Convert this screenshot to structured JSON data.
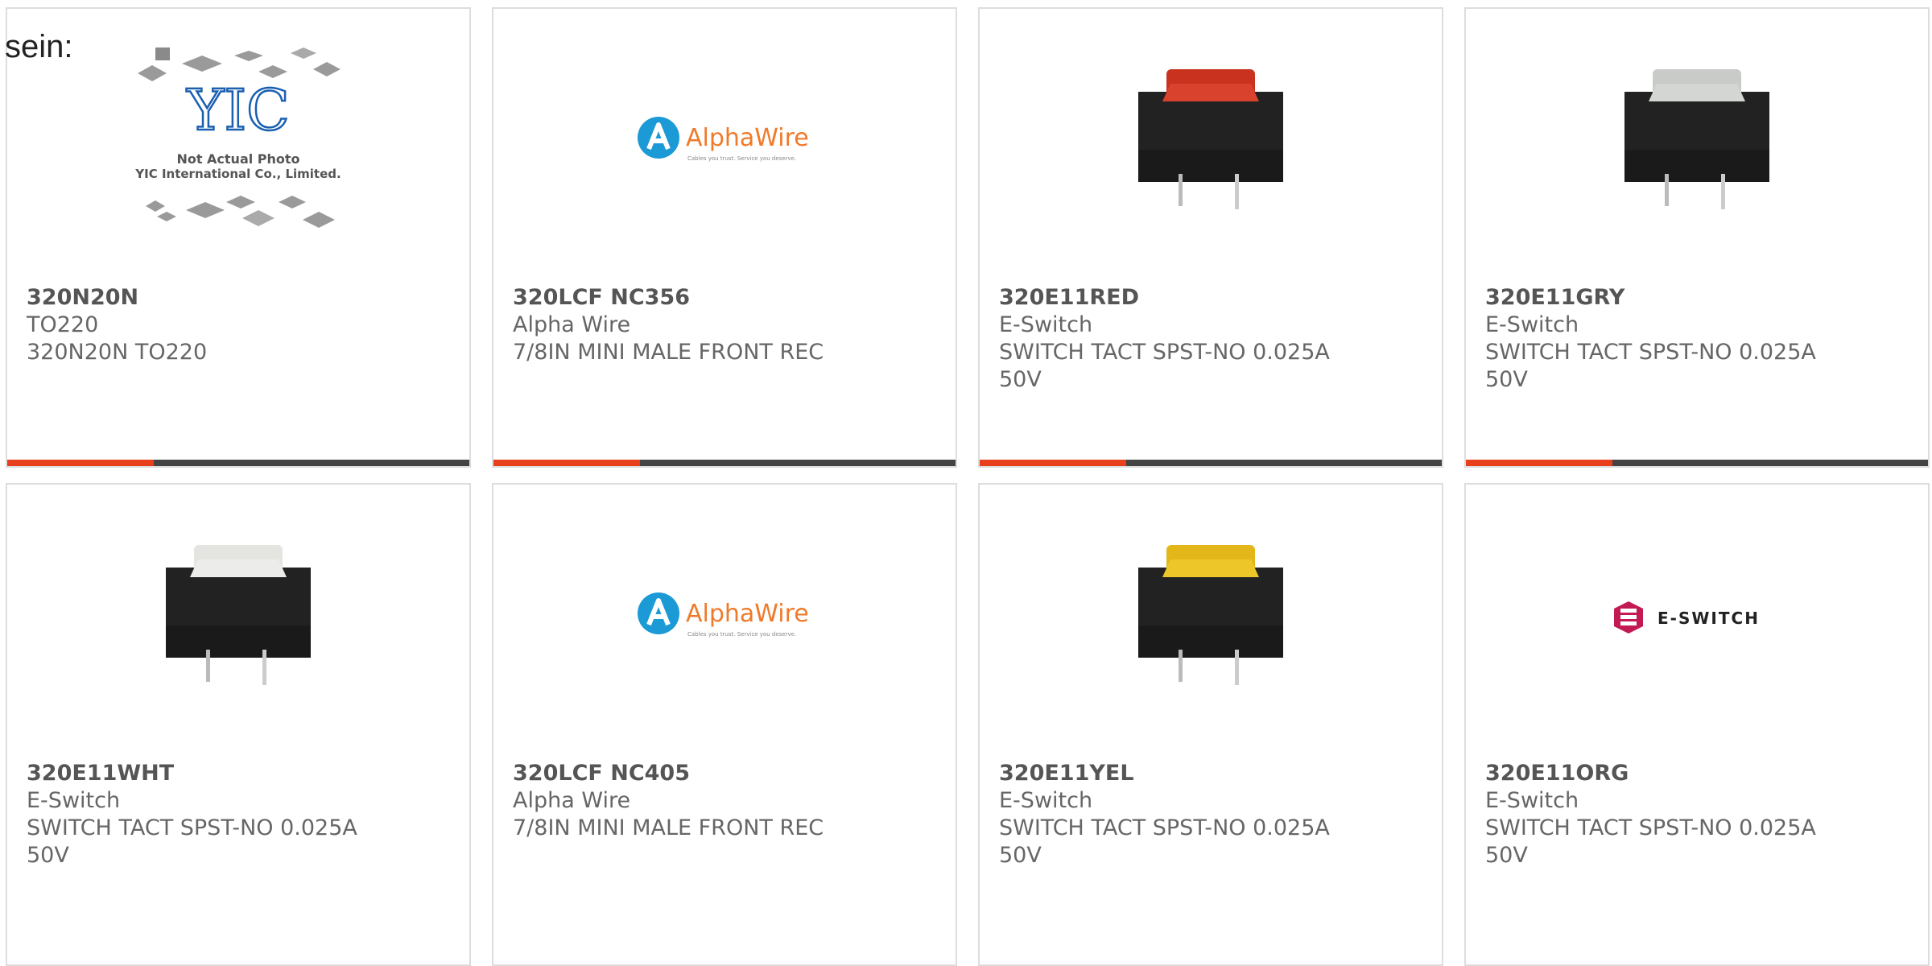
{
  "intro_text": "sein:",
  "colors": {
    "accent": "#e8401c",
    "bar_dark": "#444444",
    "border": "#dddddd"
  },
  "cards": [
    {
      "part": "320N20N",
      "maker": "TO220",
      "desc": "320N20N TO220",
      "desc2": "",
      "image": "not-actual-photo-placeholder",
      "img_caption1": "Not Actual Photo",
      "img_caption2": "YIC International Co., Limited.",
      "img_logo": "YIC"
    },
    {
      "part": "320LCF NC356",
      "maker": "Alpha Wire",
      "desc": "7/8IN MINI MALE FRONT REC",
      "desc2": "",
      "image": "alphawire-logo",
      "logo_text": "AlphaWire",
      "logo_tagline": "Cables you trust. Service you deserve."
    },
    {
      "part": "320E11RED",
      "maker": "E-Switch",
      "desc": "SWITCH TACT SPST-NO 0.025A",
      "desc2": "50V",
      "image": "tact-switch-photo",
      "cap_color": "#c8321e"
    },
    {
      "part": "320E11GRY",
      "maker": "E-Switch",
      "desc": "SWITCH TACT SPST-NO 0.025A",
      "desc2": "50V",
      "image": "tact-switch-photo",
      "cap_color": "#c9cbc9"
    },
    {
      "part": "320E11WHT",
      "maker": "E-Switch",
      "desc": "SWITCH TACT SPST-NO 0.025A",
      "desc2": "50V",
      "image": "tact-switch-photo",
      "cap_color": "#e4e4e0"
    },
    {
      "part": "320LCF NC405",
      "maker": "Alpha Wire",
      "desc": "7/8IN MINI MALE FRONT REC",
      "desc2": "",
      "image": "alphawire-logo",
      "logo_text": "AlphaWire",
      "logo_tagline": "Cables you trust. Service you deserve."
    },
    {
      "part": "320E11YEL",
      "maker": "E-Switch",
      "desc": "SWITCH TACT SPST-NO 0.025A",
      "desc2": "50V",
      "image": "tact-switch-photo",
      "cap_color": "#e3b71a"
    },
    {
      "part": "320E11ORG",
      "maker": "E-Switch",
      "desc": "SWITCH TACT SPST-NO 0.025A",
      "desc2": "50V",
      "image": "eswitch-logo",
      "logo_text": "E-SWITCH"
    }
  ]
}
